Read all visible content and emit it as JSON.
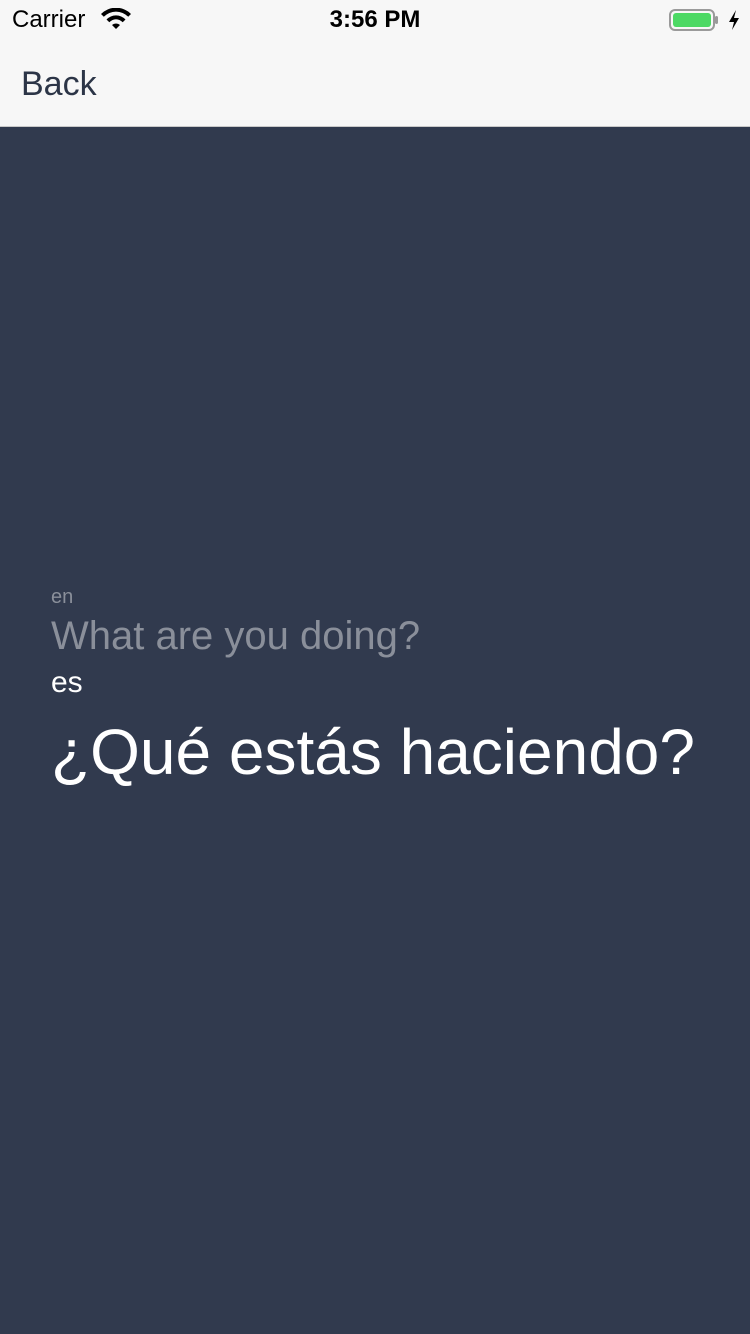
{
  "status_bar": {
    "carrier": "Carrier",
    "time": "3:56 PM",
    "wifi_icon": "wifi-icon",
    "battery_icon": "battery-charging-icon",
    "battery_color": "#4cd964"
  },
  "nav": {
    "back_label": "Back"
  },
  "translation": {
    "source_language": "en",
    "source_text": "What are you doing?",
    "target_language": "es",
    "target_text": "¿Qué estás haciendo?"
  },
  "colors": {
    "background": "#313a4e",
    "nav_background": "#f7f7f7",
    "muted_text": "#8a8f9a",
    "primary_text": "#ffffff"
  }
}
